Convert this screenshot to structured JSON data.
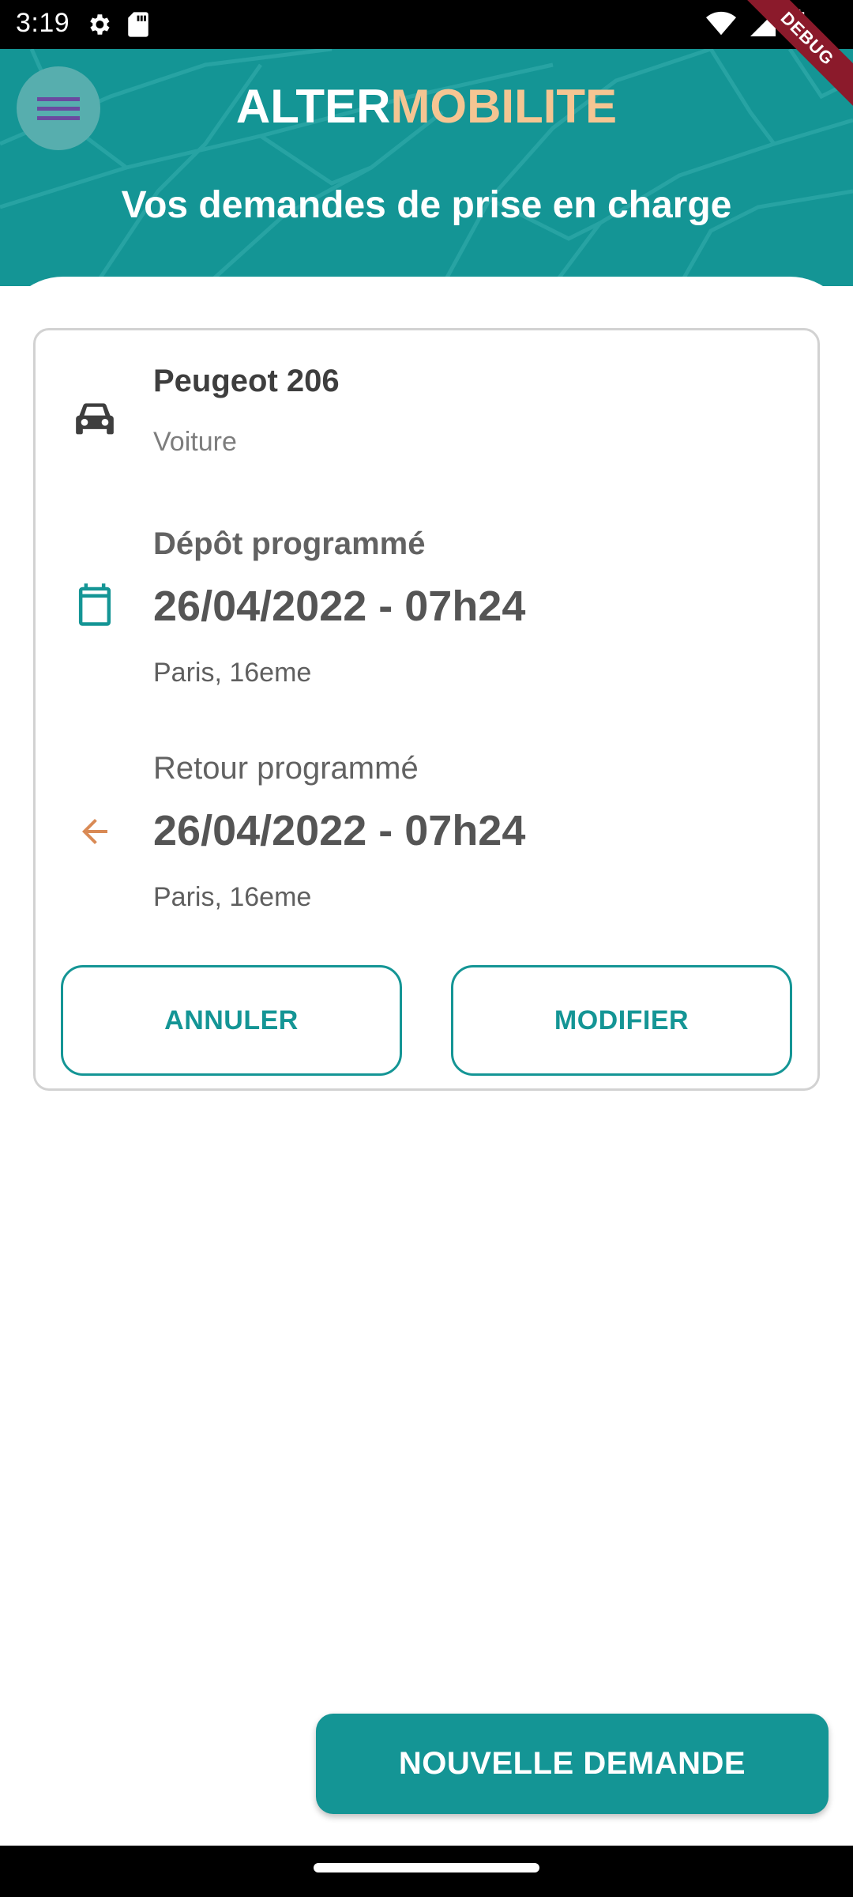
{
  "status_bar": {
    "time": "3:19",
    "icons": [
      "settings-icon",
      "sd-card-icon",
      "wifi-icon",
      "signal-icon",
      "battery-icon"
    ]
  },
  "debug_banner": "DEBUG",
  "header": {
    "brand_part1": "ALTER",
    "brand_part2": "MOBILITE",
    "title": "Vos demandes de prise en charge",
    "colors": {
      "primary": "#149595",
      "brand_accent": "#f5c592",
      "menu_icon": "#6a4aa0"
    }
  },
  "request": {
    "vehicle_name": "Peugeot 206",
    "vehicle_type": "Voiture",
    "drop": {
      "label": "Dépôt programmé",
      "datetime": "26/04/2022 - 07h24",
      "place": "Paris, 16eme"
    },
    "return": {
      "label": "Retour programmé",
      "datetime": "26/04/2022 - 07h24",
      "place": "Paris, 16eme",
      "arrow_color": "#d98a55"
    },
    "cancel_label": "ANNULER",
    "edit_label": "MODIFIER"
  },
  "new_request_label": "NOUVELLE DEMANDE"
}
